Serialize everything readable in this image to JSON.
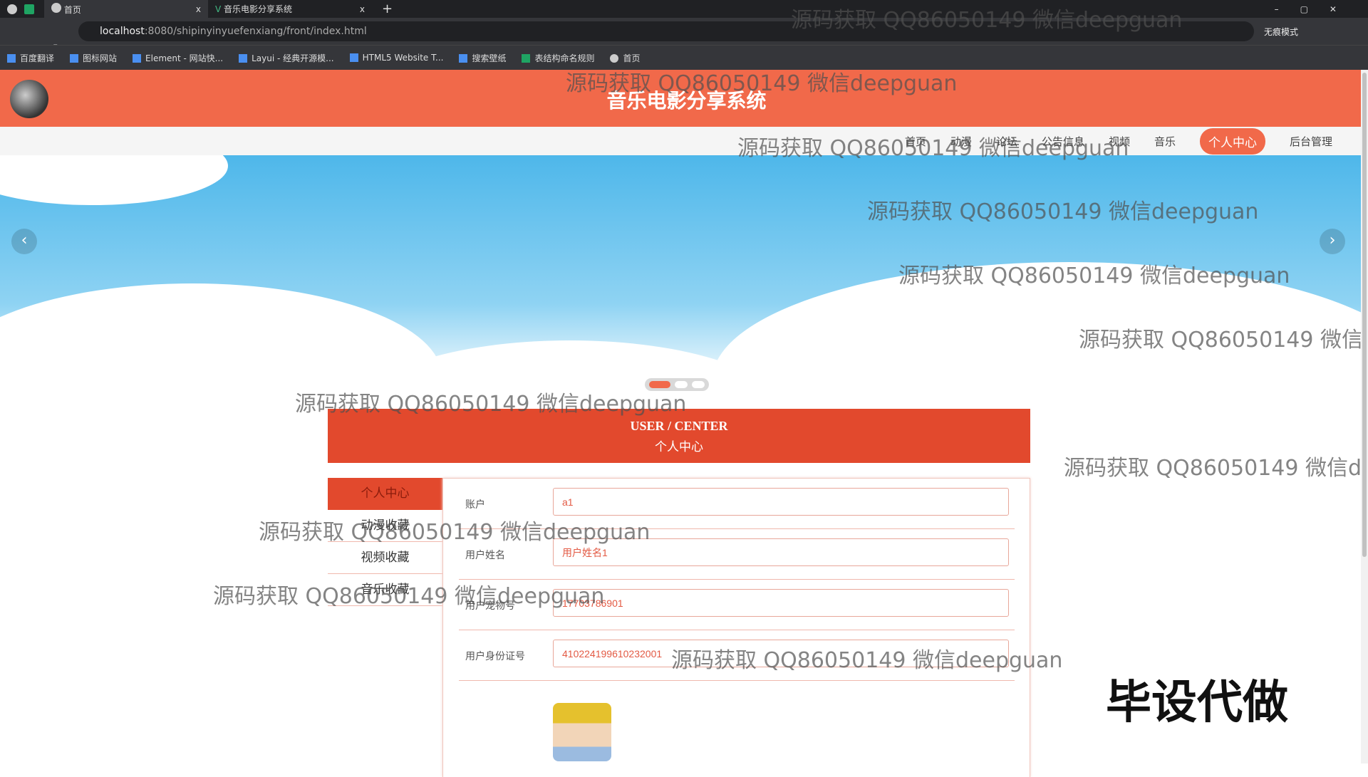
{
  "browser": {
    "tabs": [
      {
        "title": "首页"
      },
      {
        "title": "音乐电影分享系统"
      }
    ],
    "new_tab": "+",
    "close": "x",
    "url_host": "localhost",
    "url_path": ":8080/shipinyinyuefenxiang/front/index.html",
    "profile": "无痕模式",
    "bookmarks": [
      "百度翻译",
      "图标网站",
      "Element - 网站快...",
      "Layui - 经典开源模...",
      "HTML5 Website T...",
      "搜索壁纸",
      "表结构命名规则",
      "首页"
    ]
  },
  "header": {
    "title": "音乐电影分享系统"
  },
  "nav": {
    "items": [
      "首页",
      "动漫",
      "论坛",
      "公告信息",
      "视频",
      "音乐",
      "个人中心",
      "后台管理"
    ],
    "active": "个人中心"
  },
  "banner": {
    "prev": "‹",
    "next": "›",
    "slides": 3,
    "active_slide": 1
  },
  "user_center": {
    "title_en": "USER / CENTER",
    "title_cn": "个人中心"
  },
  "sidebar": {
    "items": [
      "个人中心",
      "动漫收藏",
      "视频收藏",
      "音乐收藏"
    ]
  },
  "form": {
    "fields": [
      {
        "label": "账户",
        "value": "a1"
      },
      {
        "label": "用户姓名",
        "value": "用户姓名1"
      },
      {
        "label": "用户宠物号",
        "value": "17703786901"
      },
      {
        "label": "用户身份证号",
        "value": "410224199610232001"
      }
    ]
  },
  "watermark": "源码获取 QQ86050149 微信deepguan",
  "ad_text": "毕设代做",
  "colors": {
    "accent": "#f1694a",
    "dark_accent": "#e2492d"
  }
}
